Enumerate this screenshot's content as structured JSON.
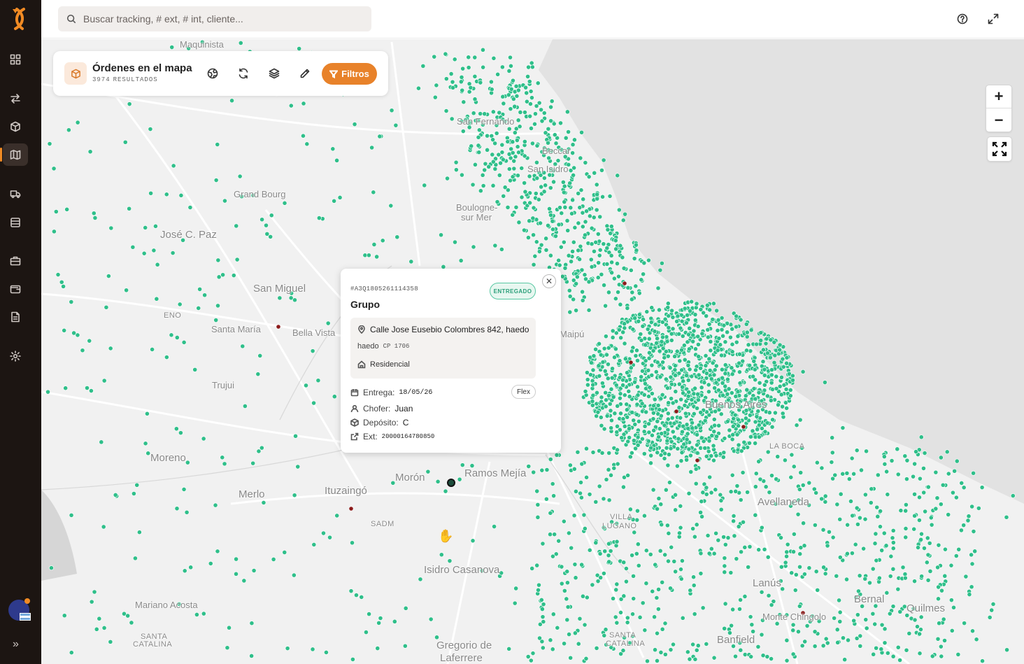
{
  "search": {
    "placeholder": "Buscar tracking, # ext, # int, cliente..."
  },
  "orders_panel": {
    "title": "Órdenes en el mapa",
    "count": "3974",
    "count_suffix": "RESULTADOS",
    "filters_label": "Filtros"
  },
  "popup": {
    "tracking": "#A3Q1805261114358",
    "status": "ENTREGADO",
    "name": "Grupo",
    "address": "Calle Jose Eusebio Colombres 842, haedo",
    "locality": "haedo",
    "postal_code": "CP 1706",
    "type": "Residencial",
    "delivery_label": "Entrega:",
    "delivery_date": "18/05/26",
    "service_tag": "Flex",
    "driver_label": "Chofer:",
    "driver": "Juan",
    "depot_label": "Depósito:",
    "depot": "C",
    "ext_label": "Ext:",
    "ext": "20000164780850"
  },
  "map": {
    "zoom_in": "+",
    "zoom_out": "−",
    "places": [
      {
        "name": "Maquinista",
        "cls": ""
      },
      {
        "name": "San Fernando",
        "cls": ""
      },
      {
        "name": "Beccar",
        "cls": ""
      },
      {
        "name": "San Isidro",
        "cls": ""
      },
      {
        "name": "Grand Bourg",
        "cls": ""
      },
      {
        "name": "Boulogne-",
        "cls": ""
      },
      {
        "name": "sur Mer",
        "cls": ""
      },
      {
        "name": "José C. Paz",
        "cls": "big"
      },
      {
        "name": "San Miguel",
        "cls": "big"
      },
      {
        "name": "ENO",
        "cls": "sm"
      },
      {
        "name": "Santa María",
        "cls": ""
      },
      {
        "name": "Bella Vista",
        "cls": ""
      },
      {
        "name": "Trujui",
        "cls": ""
      },
      {
        "name": "Moreno",
        "cls": "big"
      },
      {
        "name": "Merlo",
        "cls": "big"
      },
      {
        "name": "Ituzaingó",
        "cls": "big"
      },
      {
        "name": "Morón",
        "cls": "big"
      },
      {
        "name": "Ramos Mejía",
        "cls": "big"
      },
      {
        "name": "SADM",
        "cls": "sm"
      },
      {
        "name": "Buenos Aires",
        "cls": "big"
      },
      {
        "name": "LA BOCA",
        "cls": "sm"
      },
      {
        "name": "Avellaneda",
        "cls": "big"
      },
      {
        "name": "VILLA",
        "cls": "sm"
      },
      {
        "name": "LUGANO",
        "cls": "sm"
      },
      {
        "name": "Isidro Casanova",
        "cls": "big"
      },
      {
        "name": "Lanús",
        "cls": "big"
      },
      {
        "name": "Bernal",
        "cls": "big"
      },
      {
        "name": "Quilmes",
        "cls": "big"
      },
      {
        "name": "Monte Chingolo",
        "cls": ""
      },
      {
        "name": "Mariano Acosta",
        "cls": ""
      },
      {
        "name": "SANTA",
        "cls": "sm"
      },
      {
        "name": "CATALINA",
        "cls": "sm"
      },
      {
        "name": "SANTA",
        "cls": "sm"
      },
      {
        "name": "CATALINA",
        "cls": "sm"
      },
      {
        "name": "Banfield",
        "cls": "big"
      },
      {
        "name": "Gregorio de",
        "cls": "big"
      },
      {
        "name": "Laferrere",
        "cls": "big"
      },
      {
        "name": "Maipú",
        "cls": ""
      }
    ]
  },
  "colors": {
    "delivered_marker": "#2fbf8a",
    "issue_marker": "#8b1a1a",
    "accent": "#e8822a",
    "sidebar_bg": "#1c1512"
  },
  "icons": {
    "sidebar": [
      "dashboard-icon",
      "transfer-icon",
      "package-icon",
      "map-icon",
      "truck-icon",
      "stack-icon",
      "briefcase-icon",
      "wallet-icon",
      "report-icon",
      "settings-icon"
    ],
    "topbar": [
      "help-icon",
      "fullscreen-icon"
    ]
  }
}
